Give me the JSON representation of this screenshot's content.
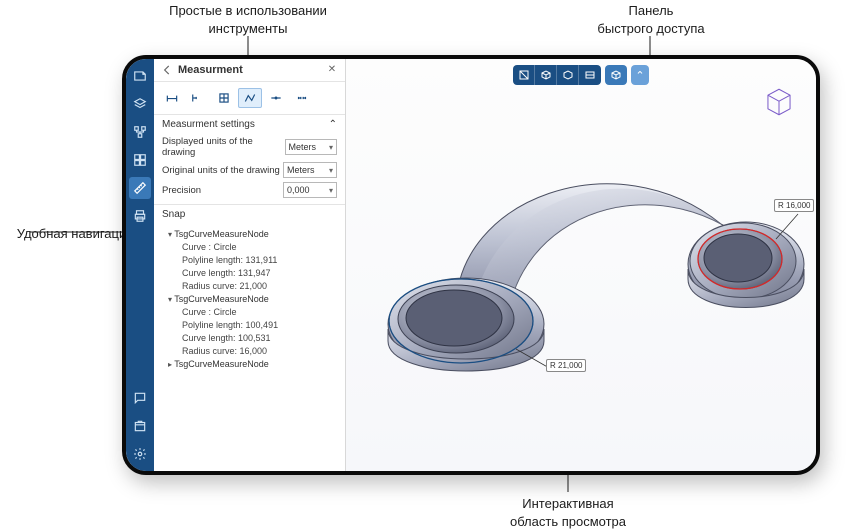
{
  "callouts": {
    "tools": "Простые в использовании\nинструменты",
    "quick_access": "Панель\nбыстрого доступа",
    "navigation": "Удобная навигация",
    "viewport": "Интерактивная\nобласть просмотра"
  },
  "panel": {
    "title": "Measurment",
    "close": "✕",
    "section_settings": "Measurment settings",
    "displayed_units_label": "Displayed units of the drawing",
    "displayed_units_value": "Meters",
    "original_units_label": "Original units of the drawing",
    "original_units_value": "Meters",
    "precision_label": "Precision",
    "precision_value": "0,000",
    "snap_label": "Snap",
    "tree": {
      "node1": "TsgCurveMeasureNode",
      "n1_curve": "Curve : Circle",
      "n1_poly": "Polyline length: 131,911",
      "n1_len": "Curve length: 131,947",
      "n1_rad": "Radius curve: 21,000",
      "node2": "TsgCurveMeasureNode",
      "n2_curve": "Curve : Circle",
      "n2_poly": "Polyline length: 100,491",
      "n2_len": "Curve length: 100,531",
      "n2_rad": "Radius curve: 16,000",
      "node3": "TsgCurveMeasureNode"
    }
  },
  "viewport": {
    "radius1": "R 16,000",
    "radius2": "R 21,000"
  }
}
